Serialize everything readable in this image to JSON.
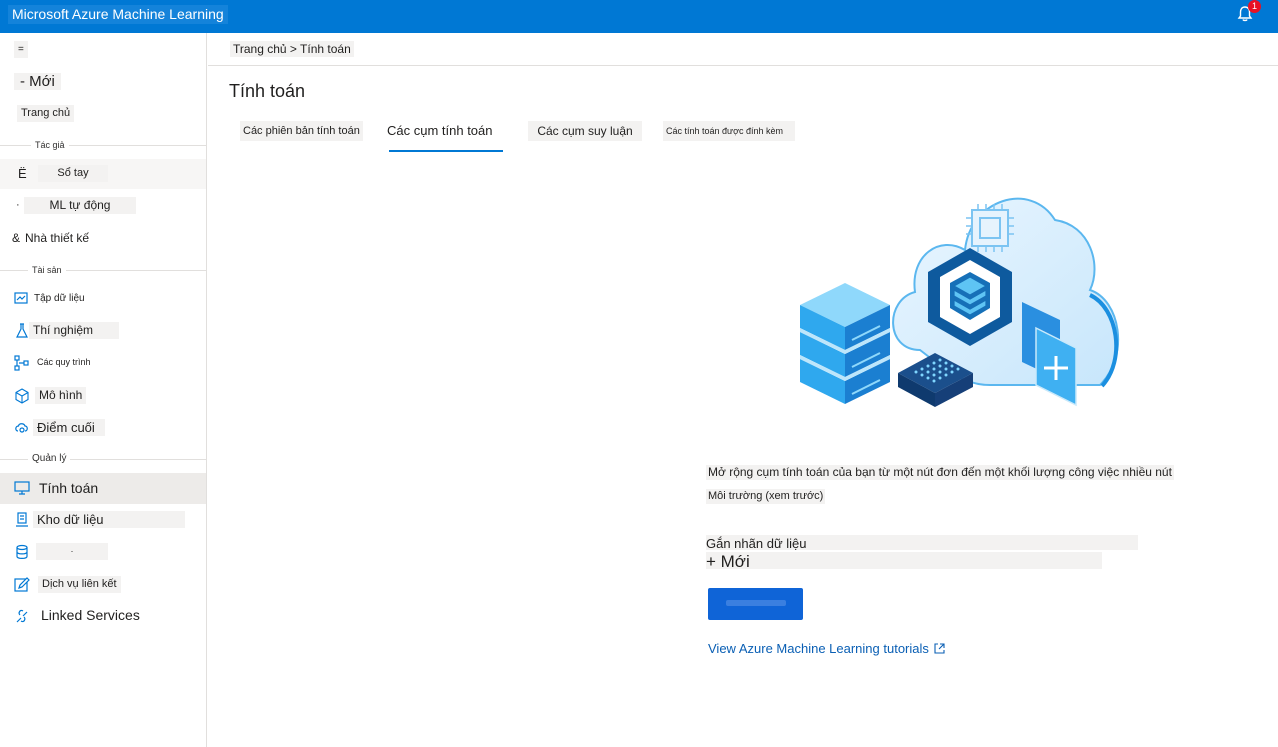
{
  "app": {
    "title": "Microsoft Azure Machine Learning",
    "notification_count": "1"
  },
  "sidebar": {
    "hamburger": "=",
    "new_label": "- Mới",
    "home": "Trang chủ",
    "sections": {
      "author": "Tác giả",
      "assets": "Tài sản",
      "manage": "Quản lý"
    },
    "author_items": [
      {
        "glyph": "Ë",
        "label": "Sổ tay"
      },
      {
        "glyph": "·",
        "label": "ML tự động"
      },
      {
        "glyph": "&",
        "label": "Nhà thiết kế"
      }
    ],
    "asset_items": [
      {
        "icon": "dataset-icon",
        "label": "Tập dữ liệu"
      },
      {
        "icon": "flask-icon",
        "label": "Thí nghiệm"
      },
      {
        "icon": "pipeline-icon",
        "label": "Các quy trình"
      },
      {
        "icon": "cube-icon",
        "label": "Mô hình"
      },
      {
        "icon": "endpoint-icon",
        "label": "Điểm cuối"
      }
    ],
    "manage_items": [
      {
        "icon": "monitor-icon",
        "label": "Tính toán",
        "selected": true
      },
      {
        "icon": "datastore-icon",
        "label": "Kho dữ liệu"
      },
      {
        "icon": "database-icon",
        "label": "·"
      },
      {
        "icon": "edit-icon",
        "label": "Dịch vụ liên kết"
      },
      {
        "icon": "linked-services-icon",
        "label": "Linked Services"
      }
    ]
  },
  "breadcrumb": "Trang chủ > Tính toán",
  "page_title": "Tính toán",
  "tabs": [
    {
      "label": "Các phiên bản tính toán"
    },
    {
      "label": "Các cụm tính toán",
      "active": true
    },
    {
      "label": "Các cụm suy luận"
    },
    {
      "label": "Các tính toán được đính kèm"
    }
  ],
  "main": {
    "description": "Mở rộng cụm tính toán của bạn từ một nút đơn đến một khối lượng công việc nhiều nút",
    "environment": "Môi trường (xem trước)",
    "data_labeling": "Gắn nhãn dữ liệu",
    "new_label": "+ Mới",
    "tutorial_link": "View Azure Machine Learning tutorials"
  },
  "colors": {
    "accent": "#0078d4",
    "badge": "#e81123",
    "button": "#0f64d7"
  }
}
